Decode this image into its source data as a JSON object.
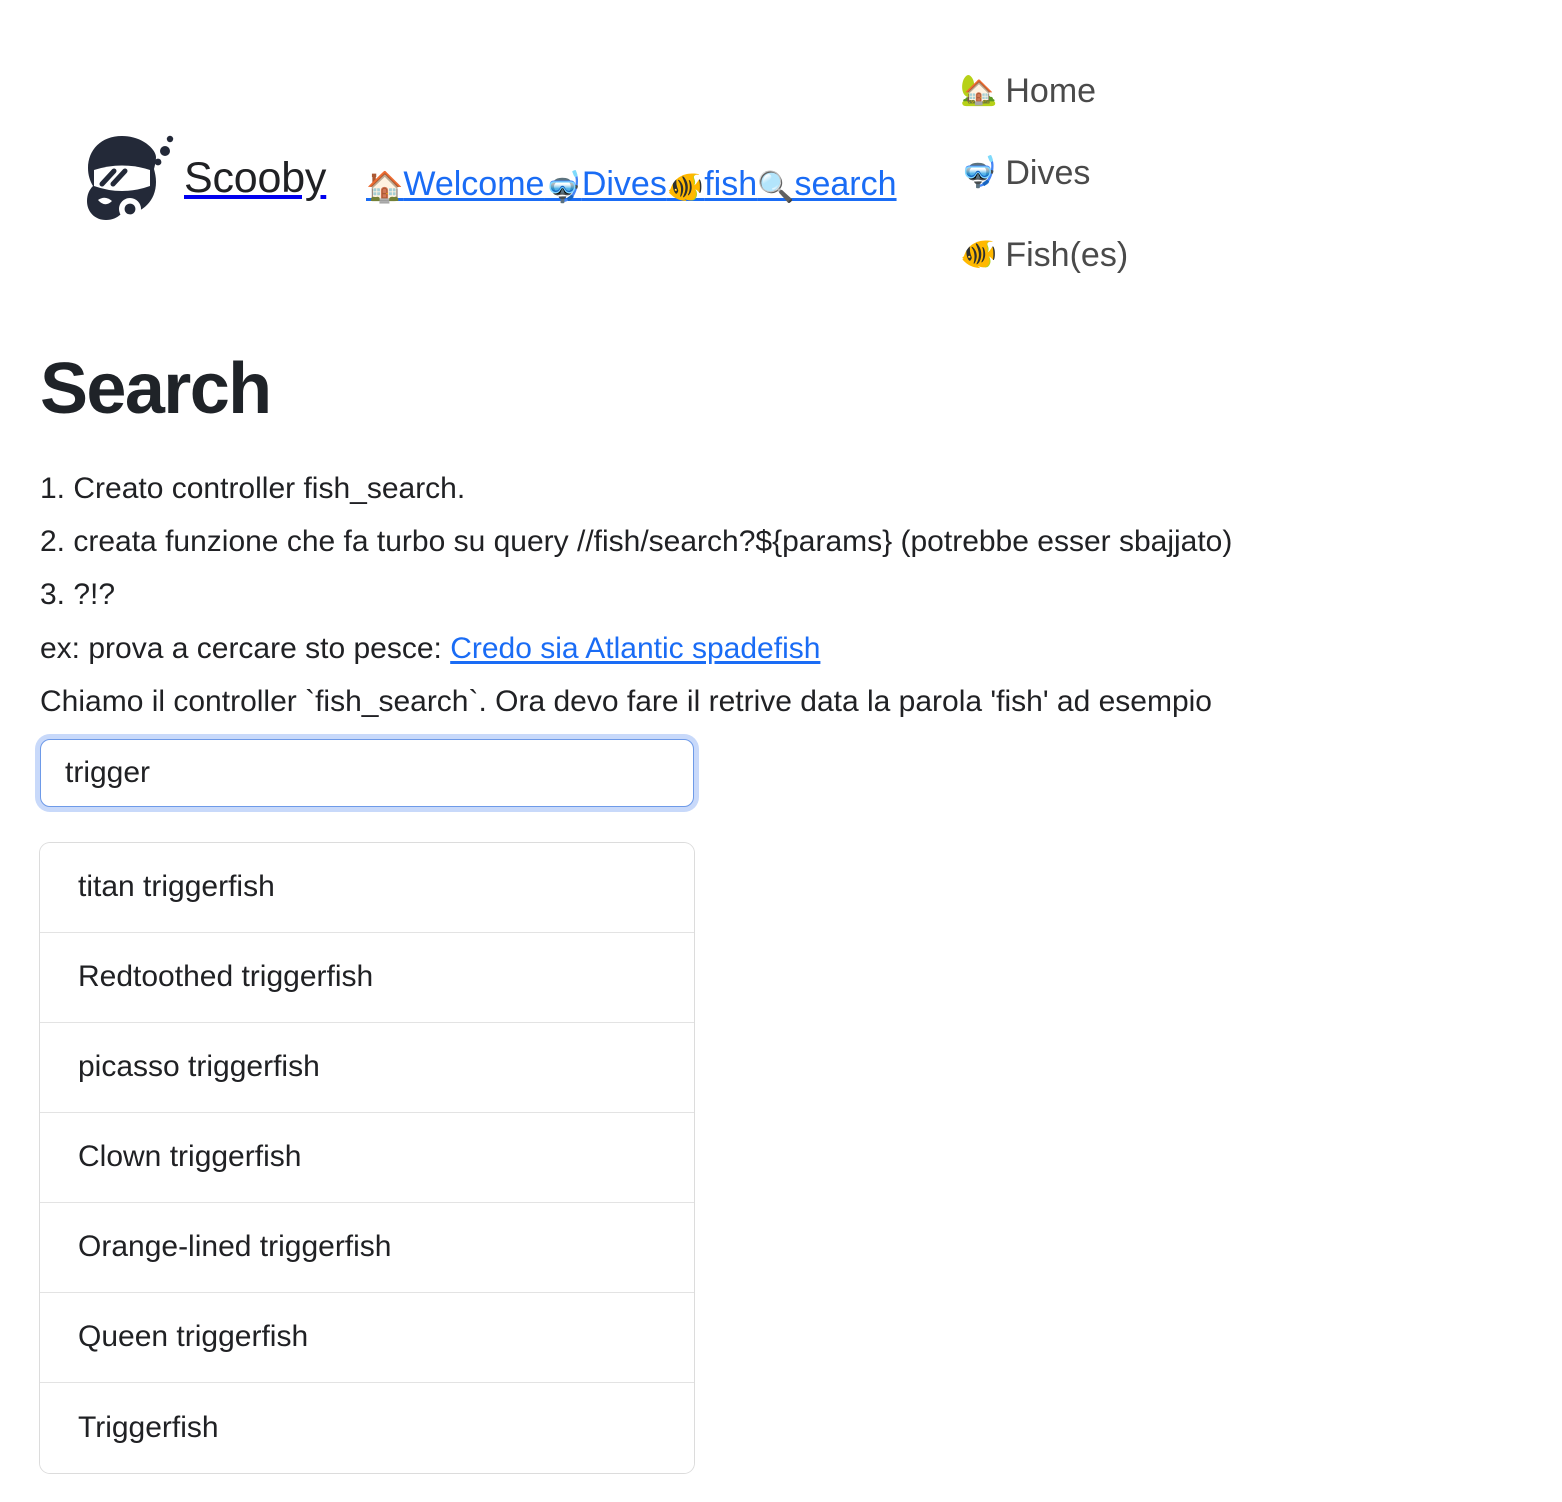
{
  "brand": {
    "name": "Scooby",
    "logo_icon": "scuba-diver-logo-icon"
  },
  "inline_nav": {
    "items": [
      {
        "emoji": "🏠",
        "label": "Welcome",
        "icon_name": "house-icon"
      },
      {
        "emoji": "🤿",
        "label": "Dives",
        "icon_name": "diving-mask-icon"
      },
      {
        "emoji": "🐠",
        "label": "fish",
        "icon_name": "tropical-fish-icon"
      },
      {
        "emoji": "🔍",
        "label": "search",
        "icon_name": "magnifying-glass-icon"
      }
    ]
  },
  "side_nav": {
    "items": [
      {
        "emoji": "🏡",
        "label": "Home",
        "icon_name": "house-with-garden-icon"
      },
      {
        "emoji": "🤿",
        "label": "Dives",
        "icon_name": "diving-mask-icon"
      },
      {
        "emoji": "🐠",
        "label": "Fish(es)",
        "icon_name": "tropical-fish-icon"
      }
    ]
  },
  "main": {
    "title": "Search",
    "notes": [
      "1. Creato controller fish_search.",
      "2. creata funzione che fa turbo su query //fish/search?${params} (potrebbe esser sbajjato)",
      "3. ?!?"
    ],
    "example_line": {
      "prefix": "ex: prova a cercare sto pesce: ",
      "link_label": "Credo sia Atlantic spadefish"
    },
    "controller_line": "Chiamo il controller `fish_search`. Ora devo fare il retrive data la parola 'fish' ad esempio"
  },
  "search": {
    "value": "trigger",
    "placeholder": ""
  },
  "results": {
    "items": [
      "titan triggerfish",
      "Redtoothed triggerfish",
      "picasso triggerfish",
      "Clown triggerfish",
      "Orange-lined triggerfish",
      "Queen triggerfish",
      "Triggerfish"
    ]
  },
  "colors": {
    "link": "#1a6cf5",
    "text": "#202124",
    "muted": "#4a4a4a",
    "focus_ring": "#9bb9f5",
    "border": "#e3e3e3",
    "logo": "#232938"
  }
}
